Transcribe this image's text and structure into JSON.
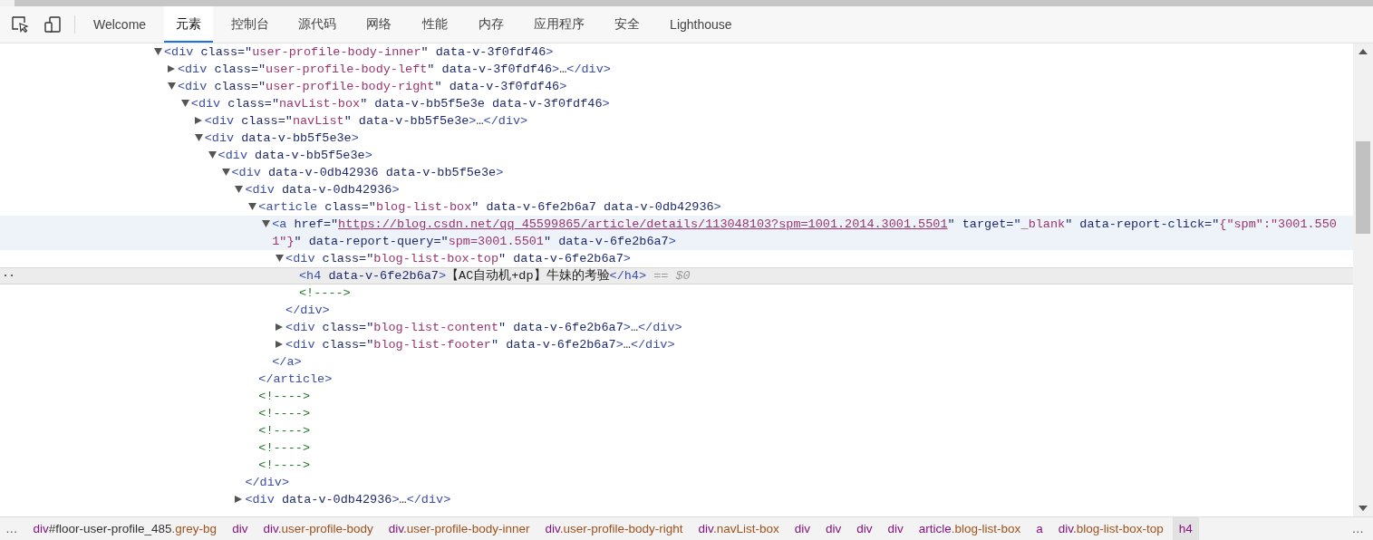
{
  "toolbar": {
    "tabs": [
      {
        "label": "Welcome",
        "selected": false
      },
      {
        "label": "元素",
        "selected": true
      },
      {
        "label": "控制台",
        "selected": false
      },
      {
        "label": "源代码",
        "selected": false
      },
      {
        "label": "网络",
        "selected": false
      },
      {
        "label": "性能",
        "selected": false
      },
      {
        "label": "内存",
        "selected": false
      },
      {
        "label": "应用程序",
        "selected": false
      },
      {
        "label": "安全",
        "selected": false
      },
      {
        "label": "Lighthouse",
        "selected": false
      }
    ]
  },
  "tree": [
    {
      "kind": "element",
      "expanded": true,
      "selected": false,
      "hovered": false,
      "open": [
        {
          "kind": "tag",
          "text": "<div"
        },
        {
          "kind": "attr",
          "text": " class=\""
        },
        {
          "kind": "value",
          "text": "user-profile-body-inner"
        },
        {
          "kind": "attr",
          "text": "\" data-v-3f0fdf46"
        },
        {
          "kind": "tag",
          "text": ">"
        }
      ],
      "children": [
        {
          "kind": "element",
          "expanded": false,
          "selected": false,
          "hovered": false,
          "open": [
            {
              "kind": "tag",
              "text": "<div"
            },
            {
              "kind": "attr",
              "text": " class=\""
            },
            {
              "kind": "value",
              "text": "user-profile-body-left"
            },
            {
              "kind": "attr",
              "text": "\" data-v-3f0fdf46"
            },
            {
              "kind": "tag",
              "text": ">"
            },
            {
              "kind": "text",
              "text": "…"
            },
            {
              "kind": "tag",
              "text": "</div>"
            }
          ]
        },
        {
          "kind": "element",
          "expanded": true,
          "selected": false,
          "hovered": false,
          "open": [
            {
              "kind": "tag",
              "text": "<div"
            },
            {
              "kind": "attr",
              "text": " class=\""
            },
            {
              "kind": "value",
              "text": "user-profile-body-right"
            },
            {
              "kind": "attr",
              "text": "\" data-v-3f0fdf46"
            },
            {
              "kind": "tag",
              "text": ">"
            }
          ],
          "children": [
            {
              "kind": "element",
              "expanded": true,
              "selected": false,
              "hovered": false,
              "open": [
                {
                  "kind": "tag",
                  "text": "<div"
                },
                {
                  "kind": "attr",
                  "text": " class=\""
                },
                {
                  "kind": "value",
                  "text": "navList-box"
                },
                {
                  "kind": "attr",
                  "text": "\" data-v-bb5f5e3e data-v-3f0fdf46"
                },
                {
                  "kind": "tag",
                  "text": ">"
                }
              ],
              "children": [
                {
                  "kind": "element",
                  "expanded": false,
                  "selected": false,
                  "hovered": false,
                  "open": [
                    {
                      "kind": "tag",
                      "text": "<div"
                    },
                    {
                      "kind": "attr",
                      "text": " class=\""
                    },
                    {
                      "kind": "value",
                      "text": "navList"
                    },
                    {
                      "kind": "attr",
                      "text": "\" data-v-bb5f5e3e"
                    },
                    {
                      "kind": "tag",
                      "text": ">"
                    },
                    {
                      "kind": "text",
                      "text": "…"
                    },
                    {
                      "kind": "tag",
                      "text": "</div>"
                    }
                  ]
                },
                {
                  "kind": "element",
                  "expanded": true,
                  "selected": false,
                  "hovered": false,
                  "open": [
                    {
                      "kind": "tag",
                      "text": "<div"
                    },
                    {
                      "kind": "attr",
                      "text": " data-v-bb5f5e3e"
                    },
                    {
                      "kind": "tag",
                      "text": ">"
                    }
                  ],
                  "children": [
                    {
                      "kind": "element",
                      "expanded": true,
                      "selected": false,
                      "hovered": false,
                      "open": [
                        {
                          "kind": "tag",
                          "text": "<div"
                        },
                        {
                          "kind": "attr",
                          "text": " data-v-bb5f5e3e"
                        },
                        {
                          "kind": "tag",
                          "text": ">"
                        }
                      ],
                      "children": [
                        {
                          "kind": "element",
                          "expanded": true,
                          "selected": false,
                          "hovered": false,
                          "open": [
                            {
                              "kind": "tag",
                              "text": "<div"
                            },
                            {
                              "kind": "attr",
                              "text": " data-v-0db42936 data-v-bb5f5e3e"
                            },
                            {
                              "kind": "tag",
                              "text": ">"
                            }
                          ],
                          "children": [
                            {
                              "kind": "element",
                              "expanded": true,
                              "selected": false,
                              "hovered": false,
                              "open": [
                                {
                                  "kind": "tag",
                                  "text": "<div"
                                },
                                {
                                  "kind": "attr",
                                  "text": " data-v-0db42936"
                                },
                                {
                                  "kind": "tag",
                                  "text": ">"
                                }
                              ],
                              "close": [
                                {
                                  "kind": "tag",
                                  "text": "</div>"
                                }
                              ],
                              "children": [
                                {
                                  "kind": "element",
                                  "expanded": true,
                                  "selected": false,
                                  "hovered": false,
                                  "open": [
                                    {
                                      "kind": "tag",
                                      "text": "<article"
                                    },
                                    {
                                      "kind": "attr",
                                      "text": " class=\""
                                    },
                                    {
                                      "kind": "value",
                                      "text": "blog-list-box"
                                    },
                                    {
                                      "kind": "attr",
                                      "text": "\" data-v-6fe2b6a7 data-v-0db42936"
                                    },
                                    {
                                      "kind": "tag",
                                      "text": ">"
                                    }
                                  ],
                                  "close": [
                                    {
                                      "kind": "tag",
                                      "text": "</article>"
                                    }
                                  ],
                                  "children": [
                                    {
                                      "kind": "element",
                                      "expanded": true,
                                      "selected": false,
                                      "hovered": true,
                                      "open": [
                                        {
                                          "kind": "tag",
                                          "text": "<a"
                                        },
                                        {
                                          "kind": "attr",
                                          "text": " href=\""
                                        },
                                        {
                                          "kind": "link",
                                          "text": "https://blog.csdn.net/qq_45599865/article/details/113048103?spm=1001.2014.3001.5501"
                                        },
                                        {
                                          "kind": "attr",
                                          "text": "\" target=\""
                                        },
                                        {
                                          "kind": "value",
                                          "text": "_blank"
                                        },
                                        {
                                          "kind": "attr",
                                          "text": "\" data-report-click=\""
                                        },
                                        {
                                          "kind": "value",
                                          "text": "{\"spm\":\"3001.5501\"}"
                                        },
                                        {
                                          "kind": "attr",
                                          "text": "\" data-report-query=\""
                                        },
                                        {
                                          "kind": "value",
                                          "text": "spm=3001.5501"
                                        },
                                        {
                                          "kind": "attr",
                                          "text": "\" data-v-6fe2b6a7"
                                        },
                                        {
                                          "kind": "tag",
                                          "text": ">"
                                        }
                                      ],
                                      "close": [
                                        {
                                          "kind": "tag",
                                          "text": "</a>"
                                        }
                                      ],
                                      "children": [
                                        {
                                          "kind": "element",
                                          "expanded": true,
                                          "selected": false,
                                          "hovered": false,
                                          "open": [
                                            {
                                              "kind": "tag",
                                              "text": "<div"
                                            },
                                            {
                                              "kind": "attr",
                                              "text": " class=\""
                                            },
                                            {
                                              "kind": "value",
                                              "text": "blog-list-box-top"
                                            },
                                            {
                                              "kind": "attr",
                                              "text": "\" data-v-6fe2b6a7"
                                            },
                                            {
                                              "kind": "tag",
                                              "text": ">"
                                            }
                                          ],
                                          "close": [
                                            {
                                              "kind": "tag",
                                              "text": "</div>"
                                            }
                                          ],
                                          "children": [
                                            {
                                              "kind": "leaf",
                                              "selected": true,
                                              "hovered": false,
                                              "gutter": "··",
                                              "open": [
                                                {
                                                  "kind": "tag",
                                                  "text": "<h4"
                                                },
                                                {
                                                  "kind": "attr",
                                                  "text": " data-v-6fe2b6a7"
                                                },
                                                {
                                                  "kind": "tag",
                                                  "text": ">"
                                                },
                                                {
                                                  "kind": "text",
                                                  "text": "【AC自动机+dp】牛妹的考验"
                                                },
                                                {
                                                  "kind": "tag",
                                                  "text": "</h4>"
                                                },
                                                {
                                                  "kind": "ref",
                                                  "text": " == $0"
                                                }
                                              ]
                                            },
                                            {
                                              "kind": "leaf",
                                              "selected": false,
                                              "hovered": false,
                                              "open": [
                                                {
                                                  "kind": "comment",
                                                  "text": "<!---->"
                                                }
                                              ]
                                            }
                                          ]
                                        },
                                        {
                                          "kind": "element",
                                          "expanded": false,
                                          "selected": false,
                                          "hovered": false,
                                          "open": [
                                            {
                                              "kind": "tag",
                                              "text": "<div"
                                            },
                                            {
                                              "kind": "attr",
                                              "text": " class=\""
                                            },
                                            {
                                              "kind": "value",
                                              "text": "blog-list-content"
                                            },
                                            {
                                              "kind": "attr",
                                              "text": "\" data-v-6fe2b6a7"
                                            },
                                            {
                                              "kind": "tag",
                                              "text": ">"
                                            },
                                            {
                                              "kind": "text",
                                              "text": "…"
                                            },
                                            {
                                              "kind": "tag",
                                              "text": "</div>"
                                            }
                                          ]
                                        },
                                        {
                                          "kind": "element",
                                          "expanded": false,
                                          "selected": false,
                                          "hovered": false,
                                          "open": [
                                            {
                                              "kind": "tag",
                                              "text": "<div"
                                            },
                                            {
                                              "kind": "attr",
                                              "text": " class=\""
                                            },
                                            {
                                              "kind": "value",
                                              "text": "blog-list-footer"
                                            },
                                            {
                                              "kind": "attr",
                                              "text": "\" data-v-6fe2b6a7"
                                            },
                                            {
                                              "kind": "tag",
                                              "text": ">"
                                            },
                                            {
                                              "kind": "text",
                                              "text": "…"
                                            },
                                            {
                                              "kind": "tag",
                                              "text": "</div>"
                                            }
                                          ]
                                        }
                                      ]
                                    }
                                  ]
                                },
                                {
                                  "kind": "leaf",
                                  "selected": false,
                                  "hovered": false,
                                  "open": [
                                    {
                                      "kind": "comment",
                                      "text": "<!---->"
                                    }
                                  ]
                                },
                                {
                                  "kind": "leaf",
                                  "selected": false,
                                  "hovered": false,
                                  "open": [
                                    {
                                      "kind": "comment",
                                      "text": "<!---->"
                                    }
                                  ]
                                },
                                {
                                  "kind": "leaf",
                                  "selected": false,
                                  "hovered": false,
                                  "open": [
                                    {
                                      "kind": "comment",
                                      "text": "<!---->"
                                    }
                                  ]
                                },
                                {
                                  "kind": "leaf",
                                  "selected": false,
                                  "hovered": false,
                                  "open": [
                                    {
                                      "kind": "comment",
                                      "text": "<!---->"
                                    }
                                  ]
                                },
                                {
                                  "kind": "leaf",
                                  "selected": false,
                                  "hovered": false,
                                  "open": [
                                    {
                                      "kind": "comment",
                                      "text": "<!---->"
                                    }
                                  ]
                                }
                              ]
                            },
                            {
                              "kind": "element",
                              "expanded": false,
                              "selected": false,
                              "hovered": false,
                              "open": [
                                {
                                  "kind": "tag",
                                  "text": "<div"
                                },
                                {
                                  "kind": "attr",
                                  "text": " data-v-0db42936"
                                },
                                {
                                  "kind": "tag",
                                  "text": ">"
                                },
                                {
                                  "kind": "text",
                                  "text": "…"
                                },
                                {
                                  "kind": "tag",
                                  "text": "</div>"
                                }
                              ]
                            }
                          ]
                        }
                      ]
                    }
                  ]
                }
              ]
            }
          ]
        }
      ]
    }
  ],
  "breadcrumbs": {
    "more_left": "…",
    "more_right": "…",
    "items": [
      {
        "tag": "div",
        "id": "#floor-user-profile_485",
        "classes": ".grey-bg",
        "selected": false
      },
      {
        "tag": "div",
        "selected": false
      },
      {
        "tag": "div",
        "classes": ".user-profile-body",
        "selected": false
      },
      {
        "tag": "div",
        "classes": ".user-profile-body-inner",
        "selected": false
      },
      {
        "tag": "div",
        "classes": ".user-profile-body-right",
        "selected": false
      },
      {
        "tag": "div",
        "classes": ".navList-box",
        "selected": false
      },
      {
        "tag": "div",
        "selected": false
      },
      {
        "tag": "div",
        "selected": false
      },
      {
        "tag": "div",
        "selected": false
      },
      {
        "tag": "div",
        "selected": false
      },
      {
        "tag": "article",
        "classes": ".blog-list-box",
        "selected": false
      },
      {
        "tag": "a",
        "selected": false
      },
      {
        "tag": "div",
        "classes": ".blog-list-box-top",
        "selected": false
      },
      {
        "tag": "h4",
        "selected": true
      }
    ]
  }
}
